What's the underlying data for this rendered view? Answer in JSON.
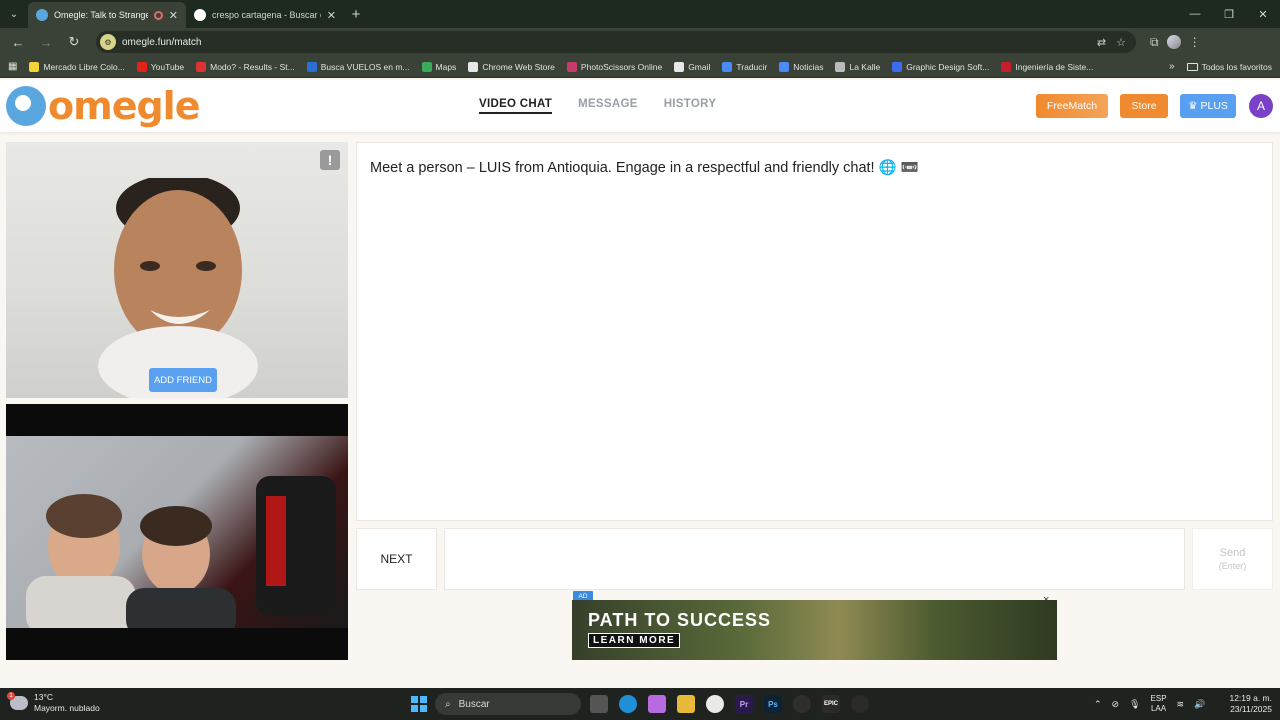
{
  "browser": {
    "tabs": [
      {
        "title": "Omegle: Talk to Strangers w",
        "active": true
      },
      {
        "title": "crespo cartagena - Buscar con",
        "active": false
      }
    ],
    "url": "omegle.fun/match",
    "bookmarks": [
      {
        "label": "Mercado Libre Colo...",
        "color": "#f2d33a"
      },
      {
        "label": "YouTube",
        "color": "#e62117"
      },
      {
        "label": "Modo? - Results - St...",
        "color": "#d33"
      },
      {
        "label": "Busca VUELOS en m...",
        "color": "#2b6fd6"
      },
      {
        "label": "Maps",
        "color": "#3bab5a"
      },
      {
        "label": "Chrome Web Store",
        "color": "#e8e8e8"
      },
      {
        "label": "PhotoScissors Online",
        "color": "#c73a6c"
      },
      {
        "label": "Gmail",
        "color": "#e8e8e8"
      },
      {
        "label": "Traducir",
        "color": "#4a8af4"
      },
      {
        "label": "Noticias",
        "color": "#4a8af4"
      },
      {
        "label": "La Kalle",
        "color": "#bbb"
      },
      {
        "label": "Graphic Design Soft...",
        "color": "#3b6cf0"
      },
      {
        "label": "Ingeniería de Siste...",
        "color": "#c8202a"
      }
    ],
    "all_bookmarks": "Todos los favoritos"
  },
  "site": {
    "logo": "omegle",
    "nav": [
      "VIDEO CHAT",
      "MESSAGE",
      "HISTORY"
    ],
    "freematch": "FreeMatch",
    "store": "Store",
    "plus": "PLUS",
    "avatar_initial": "A"
  },
  "video": {
    "report": "!",
    "add_friend": "ADD FRIEND"
  },
  "chat": {
    "message": "Meet a person – LUIS from Antioquia. Engage in a respectful and friendly chat! 🌐 📼",
    "next": "NEXT",
    "send": "Send",
    "send_hint": "(Enter)"
  },
  "ad": {
    "badge": "AD",
    "title": "PATH TO SUCCESS",
    "cta": "LEARN MORE",
    "close": "×"
  },
  "taskbar": {
    "temp": "13°C",
    "weather": "Mayorm. nublado",
    "weather_badge": "1",
    "search": "Buscar",
    "lang_top": "ESP",
    "lang_bottom": "LAA",
    "time": "12:19 a. m.",
    "date": "23/11/2025"
  }
}
